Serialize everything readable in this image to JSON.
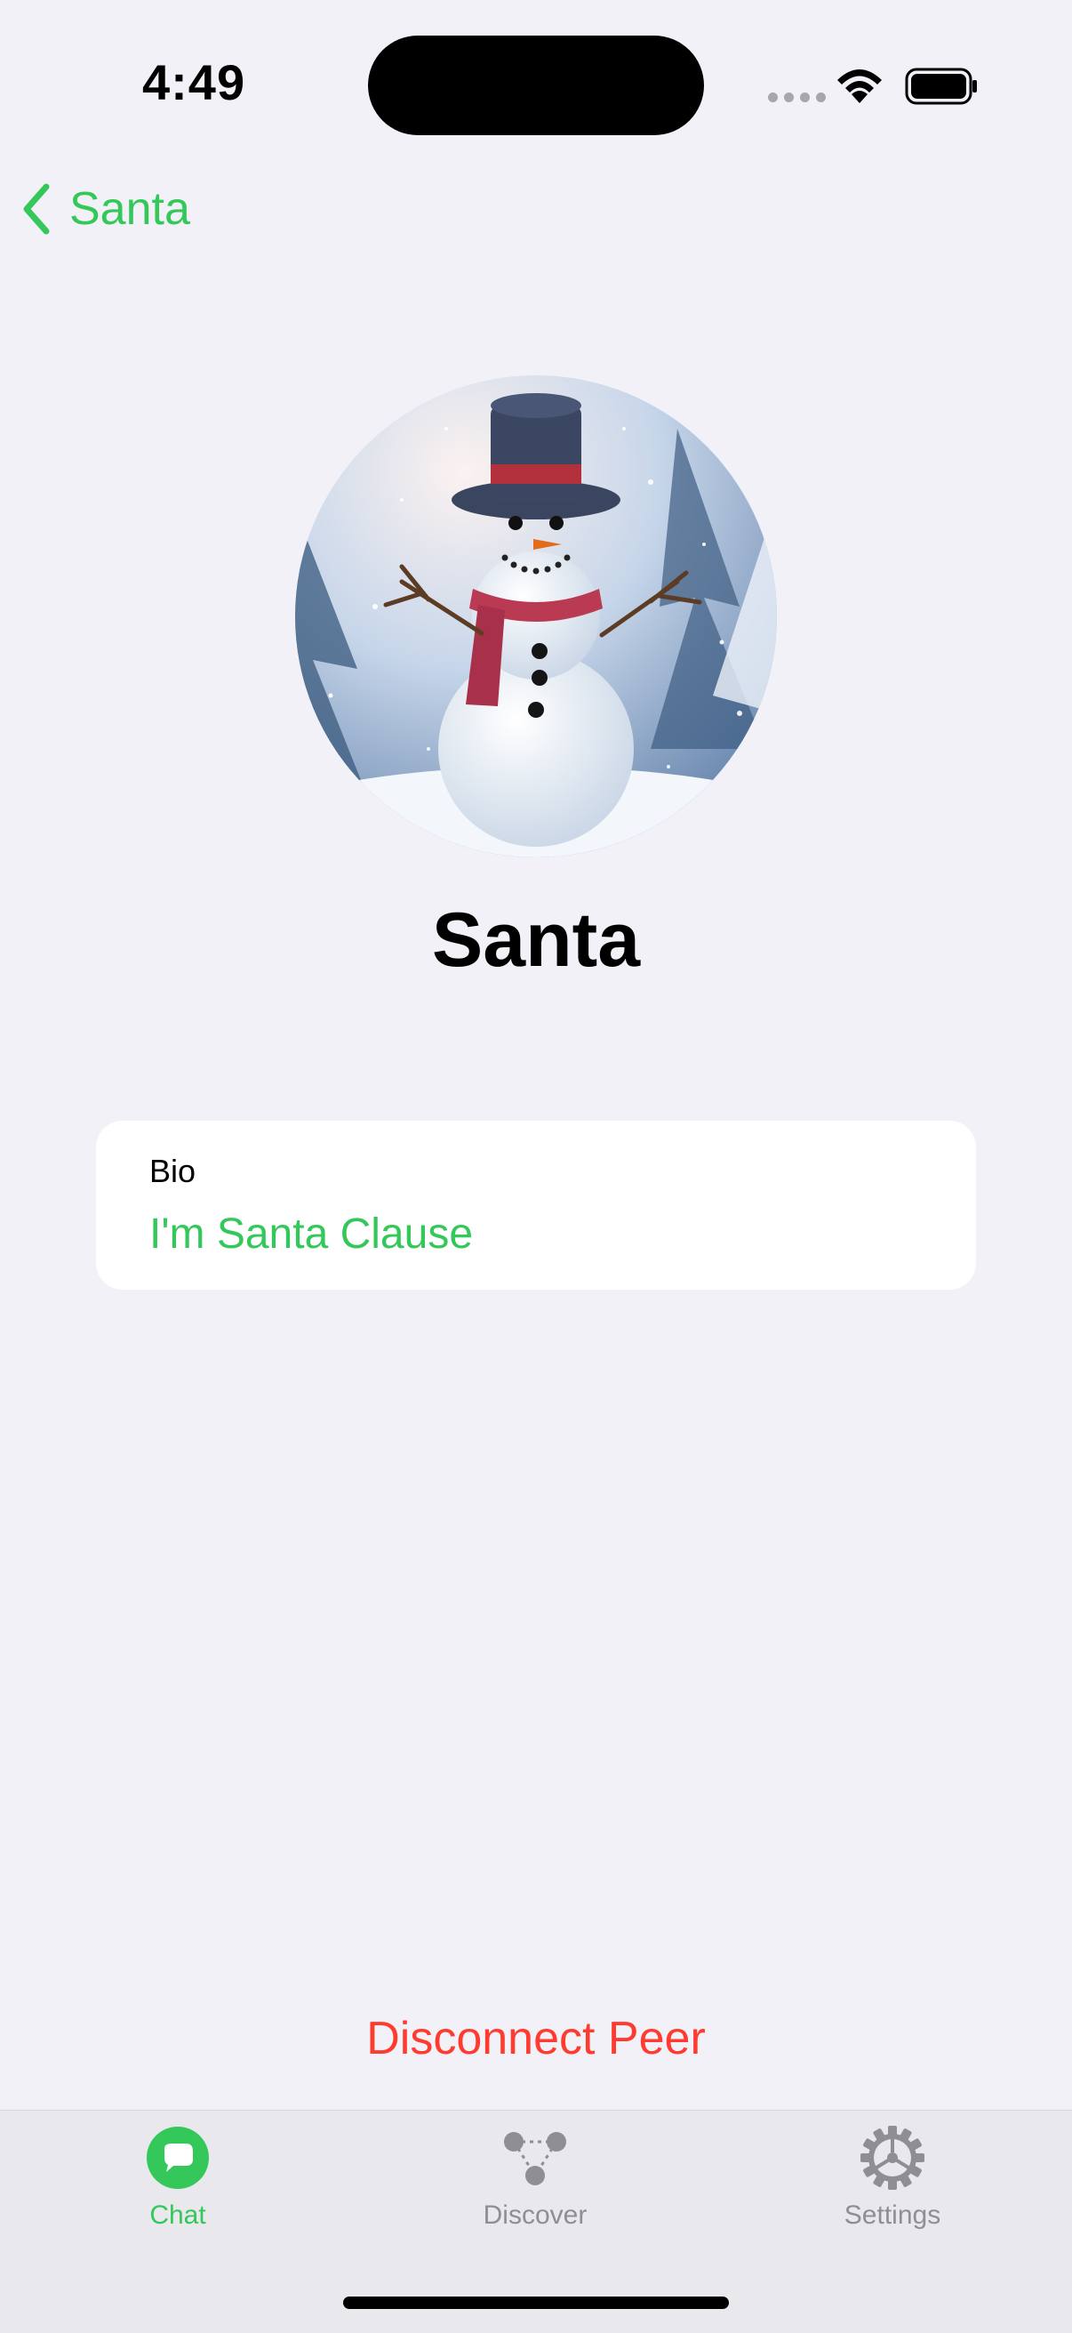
{
  "status_bar": {
    "time": "4:49"
  },
  "nav": {
    "back_label": "Santa"
  },
  "profile": {
    "name": "Santa",
    "bio_label": "Bio",
    "bio_value": "I'm Santa Clause"
  },
  "actions": {
    "disconnect_label": "Disconnect Peer"
  },
  "tabbar": {
    "tabs": [
      {
        "label": "Chat",
        "icon": "chat-bubble-icon",
        "active": true
      },
      {
        "label": "Discover",
        "icon": "network-nodes-icon",
        "active": false
      },
      {
        "label": "Settings",
        "icon": "gear-icon",
        "active": false
      }
    ]
  },
  "colors": {
    "accent": "#34c759",
    "destructive": "#ff3b30",
    "inactive": "#8e8e93",
    "background": "#f2f1f7"
  }
}
